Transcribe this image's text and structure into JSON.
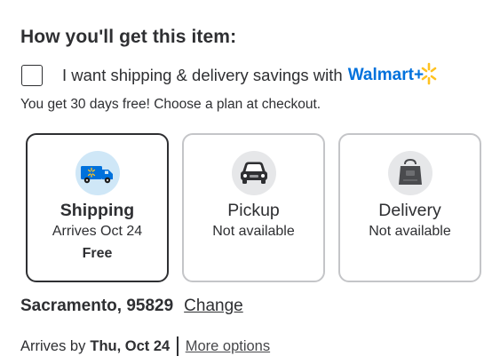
{
  "section": {
    "heading": "How you'll get this item:"
  },
  "walmart_plus": {
    "checkbox_label": "I want shipping & delivery savings with",
    "brand": "Walmart+",
    "checked": false,
    "subtext": "You get 30 days free! Choose a plan at checkout.",
    "spark_color": "#ffc220",
    "brand_color": "#0071dc"
  },
  "fulfillment_options": [
    {
      "title": "Shipping",
      "subtitle": "Arrives Oct 24",
      "extra": "Free",
      "icon": "truck-icon",
      "selected": true
    },
    {
      "title": "Pickup",
      "subtitle": "Not available",
      "extra": "",
      "icon": "car-icon",
      "selected": false
    },
    {
      "title": "Delivery",
      "subtitle": "Not available",
      "extra": "",
      "icon": "bag-icon",
      "selected": false
    }
  ],
  "location": {
    "text": "Sacramento, 95829",
    "change_label": "Change"
  },
  "arrival": {
    "prefix": "Arrives by",
    "date": "Thu, Oct 24",
    "more_options_label": "More options"
  }
}
